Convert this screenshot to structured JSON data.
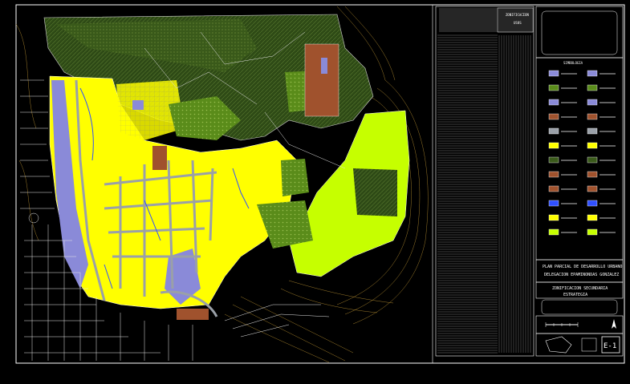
{
  "drawing": {
    "sheet_id": "E-1",
    "project_title_line1": "PLAN PARCIAL DE DESARROLLO URBANO",
    "project_title_line2": "DELEGACION EPAMINONDAS GONZALEZ",
    "plan_subtitle_line1": "ZONIFICACION SECUNDARIA",
    "plan_subtitle_line2": "ESTRATEGIA",
    "table_header_line1": "ZONIFICACION",
    "table_header_line2": "USOS",
    "legend_header": "SIMBOLOGIA"
  },
  "colors": {
    "background": "#000000",
    "frame": "#ffffff",
    "habitacional": "#ffff00",
    "conservacion": "#c6ff00",
    "bosque": "#3a5a1a",
    "vegetacion": "#5a8c1a",
    "equipamiento": "#8a8ad8",
    "industria": "#a0522d",
    "vialidad": "#9aa0a8",
    "curvas_nivel": "#b08a30",
    "hidrografia": "#3050ff"
  }
}
